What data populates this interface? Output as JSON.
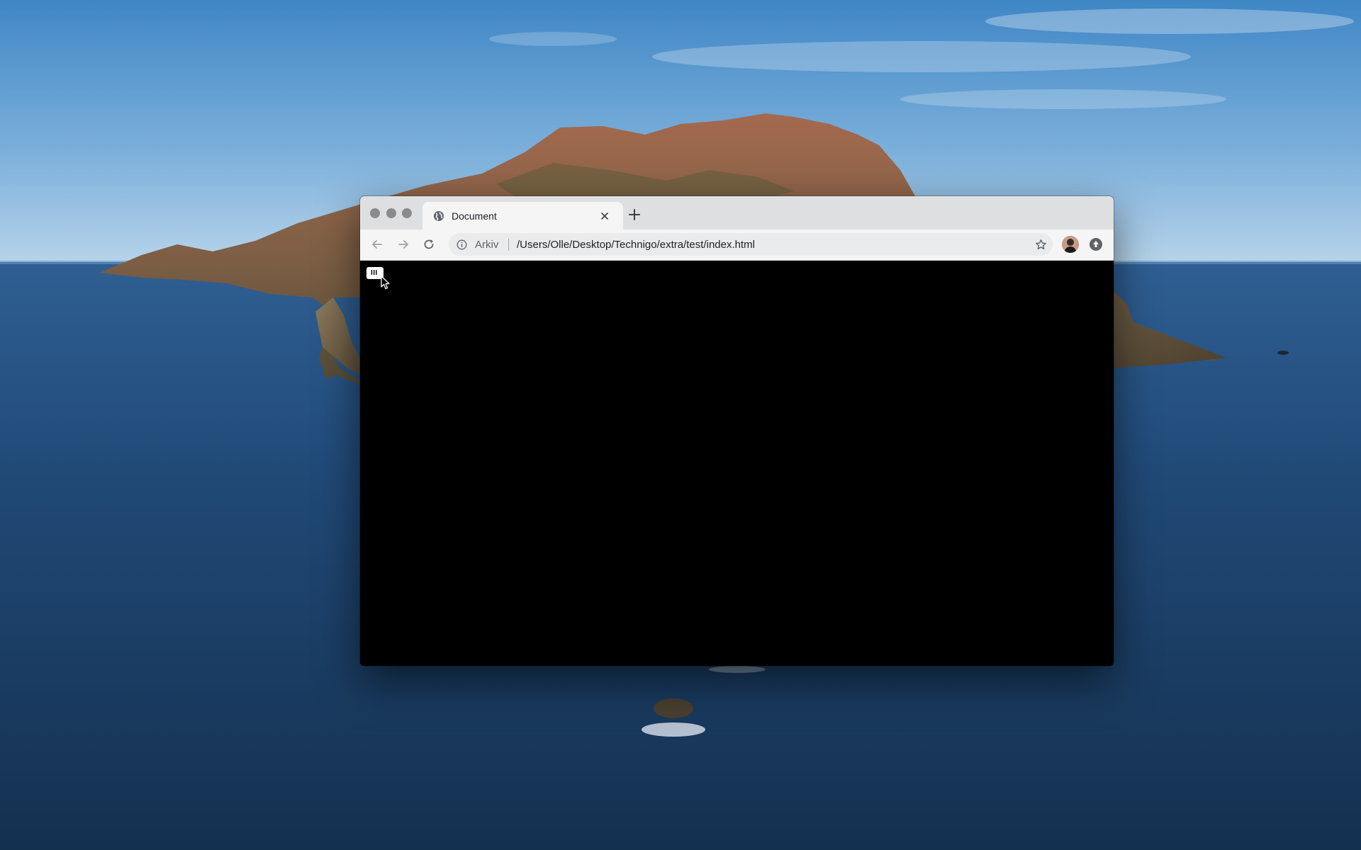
{
  "desktop": {
    "wallpaper": "coastal island landscape with sea and sky"
  },
  "browser": {
    "tab": {
      "title": "Document",
      "icon": "globe-icon"
    },
    "toolbar": {
      "scheme_label": "Arkiv",
      "url": "/Users/Olle/Desktop/Technigo/extra/test/index.html"
    },
    "page": {
      "background": "#000000",
      "menu_button_label": "III"
    }
  },
  "colors": {
    "tabstrip": "#dedfe1",
    "toolbar": "#f5f5f6",
    "omnibox": "#eaebed",
    "traffic_light": "#8b8b8d"
  }
}
